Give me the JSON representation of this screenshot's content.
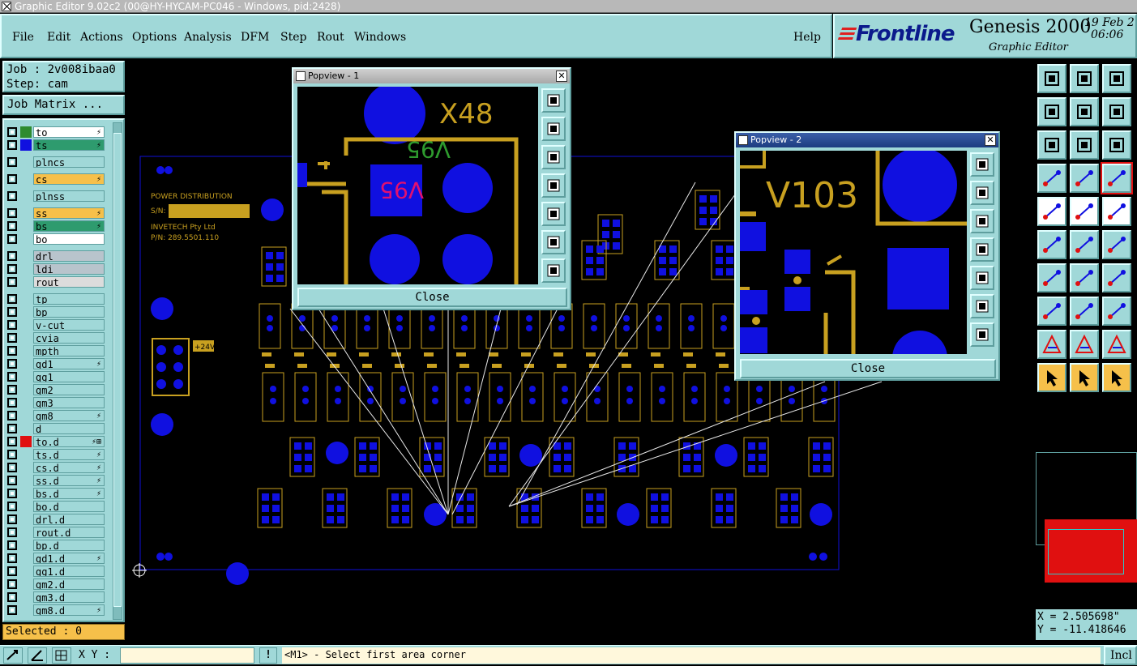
{
  "window": {
    "title": "Graphic Editor 9.02c2 (00@HY-HYCAM-PC046 - Windows, pid:2428)"
  },
  "menu": {
    "items": [
      "File",
      "Edit",
      "Actions",
      "Options",
      "Analysis",
      "DFM",
      "Step",
      "Rout",
      "Windows"
    ],
    "help": "Help"
  },
  "brand": {
    "logo": "Frontline",
    "product": "Genesis 2000",
    "subtitle": "Graphic Editor",
    "date": "19 Feb 2",
    "time": "06:06"
  },
  "job": {
    "job_line": "Job : 2v008ibaa0",
    "step_line": "Step: cam",
    "matrix_button": "Job Matrix ..."
  },
  "layers": [
    {
      "name": "to",
      "color": "#ffffff",
      "swatch": "#2e8b2e",
      "flag": "⚡"
    },
    {
      "name": "ts",
      "color": "#2e9b6e",
      "swatch": "#1010e0",
      "flag": "⚡"
    },
    {
      "name": "plncs",
      "color": "#a0d8d8",
      "swatch": "",
      "flag": ""
    },
    {
      "name": "cs",
      "color": "#f6c04a",
      "swatch": "",
      "flag": "⚡"
    },
    {
      "name": "plnss",
      "color": "#a0d8d8",
      "swatch": "",
      "flag": ""
    },
    {
      "name": "ss",
      "color": "#f6c04a",
      "swatch": "",
      "flag": "⚡"
    },
    {
      "name": "bs",
      "color": "#2e9b6e",
      "swatch": "",
      "flag": "⚡"
    },
    {
      "name": "bo",
      "color": "#ffffff",
      "swatch": "",
      "flag": ""
    },
    {
      "name": "drl",
      "color": "#b8c4cc",
      "swatch": "",
      "flag": ""
    },
    {
      "name": "ldi",
      "color": "#b8c4cc",
      "swatch": "",
      "flag": ""
    },
    {
      "name": "rout",
      "color": "#dcdcdc",
      "swatch": "",
      "flag": ""
    },
    {
      "name": "tp",
      "color": "#a0d8d8",
      "swatch": "",
      "flag": ""
    },
    {
      "name": "bp",
      "color": "#a0d8d8",
      "swatch": "",
      "flag": ""
    },
    {
      "name": "v-cut",
      "color": "#a0d8d8",
      "swatch": "",
      "flag": ""
    },
    {
      "name": "cvia",
      "color": "#a0d8d8",
      "swatch": "",
      "flag": ""
    },
    {
      "name": "mpth",
      "color": "#a0d8d8",
      "swatch": "",
      "flag": ""
    },
    {
      "name": "gd1",
      "color": "#a0d8d8",
      "swatch": "",
      "flag": "⚡"
    },
    {
      "name": "gg1",
      "color": "#a0d8d8",
      "swatch": "",
      "flag": ""
    },
    {
      "name": "gm2",
      "color": "#a0d8d8",
      "swatch": "",
      "flag": ""
    },
    {
      "name": "gm3",
      "color": "#a0d8d8",
      "swatch": "",
      "flag": ""
    },
    {
      "name": "gm8",
      "color": "#a0d8d8",
      "swatch": "",
      "flag": "⚡"
    },
    {
      "name": "d",
      "color": "#a0d8d8",
      "swatch": "",
      "flag": ""
    },
    {
      "name": "to.d",
      "color": "#a0d8d8",
      "swatch": "#e01010",
      "flag": "⚡⊞"
    },
    {
      "name": "ts.d",
      "color": "#a0d8d8",
      "swatch": "",
      "flag": "⚡"
    },
    {
      "name": "cs.d",
      "color": "#a0d8d8",
      "swatch": "",
      "flag": "⚡"
    },
    {
      "name": "ss.d",
      "color": "#a0d8d8",
      "swatch": "",
      "flag": "⚡"
    },
    {
      "name": "bs.d",
      "color": "#a0d8d8",
      "swatch": "",
      "flag": "⚡"
    },
    {
      "name": "bo.d",
      "color": "#a0d8d8",
      "swatch": "",
      "flag": ""
    },
    {
      "name": "drl.d",
      "color": "#a0d8d8",
      "swatch": "",
      "flag": ""
    },
    {
      "name": "rout.d",
      "color": "#a0d8d8",
      "swatch": "",
      "flag": ""
    },
    {
      "name": "bp.d",
      "color": "#a0d8d8",
      "swatch": "",
      "flag": ""
    },
    {
      "name": "gd1.d",
      "color": "#a0d8d8",
      "swatch": "",
      "flag": "⚡"
    },
    {
      "name": "gg1.d",
      "color": "#a0d8d8",
      "swatch": "",
      "flag": ""
    },
    {
      "name": "gm2.d",
      "color": "#a0d8d8",
      "swatch": "",
      "flag": ""
    },
    {
      "name": "gm3.d",
      "color": "#a0d8d8",
      "swatch": "",
      "flag": ""
    },
    {
      "name": "gm8.d",
      "color": "#a0d8d8",
      "swatch": "",
      "flag": "⚡"
    }
  ],
  "selected": "Selected : 0",
  "pcb": {
    "title_lines": [
      "POWER DISTRIBUTION",
      "S/N:",
      "INVETECH Pty Ltd",
      "P/N: 289.5501.110"
    ],
    "voltage_tag": "+24V"
  },
  "popview1": {
    "title": "Popview - 1",
    "label_top": "X48",
    "label_green": "V95",
    "label_pink": "V95",
    "close": "Close"
  },
  "popview2": {
    "title": "Popview - 2",
    "label_top": "V103",
    "close": "Close"
  },
  "coords": {
    "x": "X = 2.505698\"",
    "y": "Y = -11.418646"
  },
  "status": {
    "xy_label": "X Y :",
    "xy_value": "",
    "message": "<M1> - Select first area corner",
    "incl": "Incl"
  },
  "colors": {
    "panel": "#a0d8d8",
    "pad": "#1010e0",
    "copper": "#c8a020",
    "selected_bar": "#f6c04a",
    "accent_red": "#e01010"
  }
}
